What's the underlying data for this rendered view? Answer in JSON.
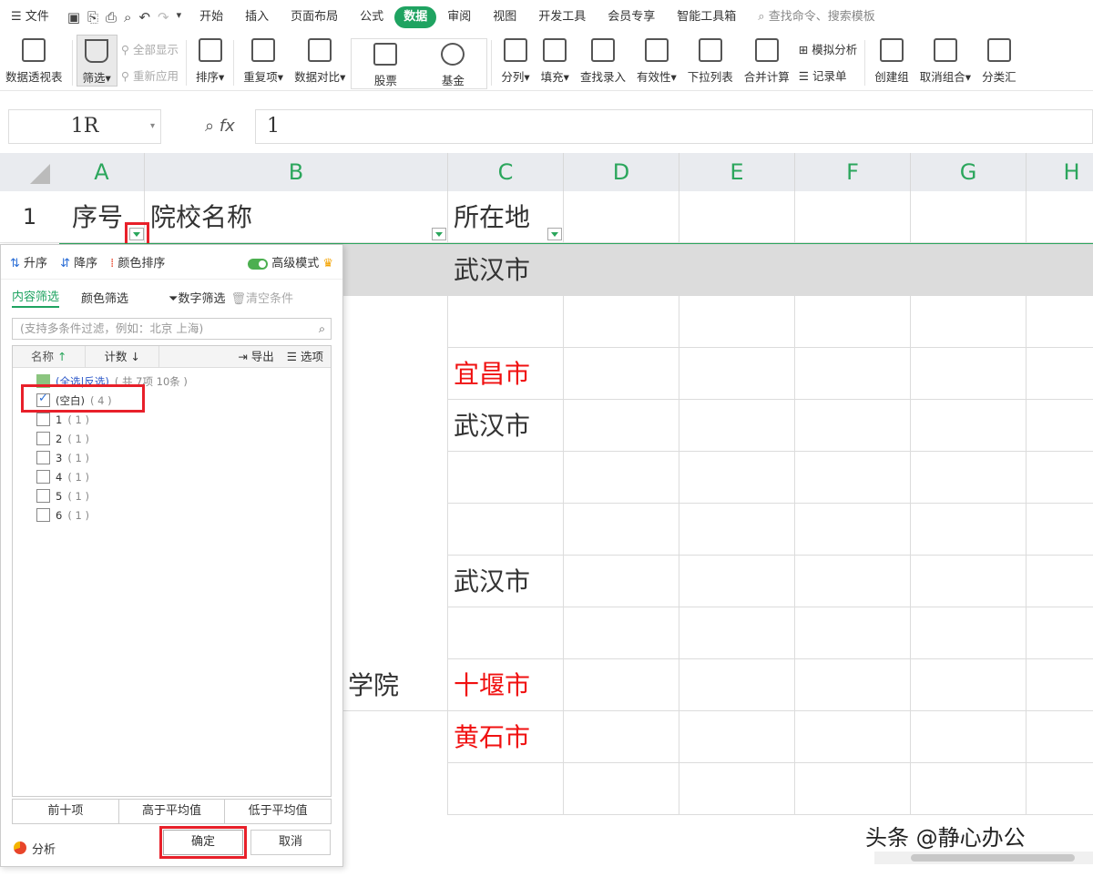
{
  "menubar": {
    "file": "文件",
    "tabs": [
      "开始",
      "插入",
      "页面布局",
      "公式",
      "数据",
      "审阅",
      "视图",
      "开发工具",
      "会员专享",
      "智能工具箱"
    ],
    "active_tab": "数据",
    "search_placeholder": "查找命令、搜索模板"
  },
  "ribbon": {
    "pivot": "数据透视表",
    "filter": "筛选",
    "show_all": "全部显示",
    "reapply": "重新应用",
    "sort": "排序",
    "duplicates": "重复项",
    "compare": "数据对比",
    "stocks": "股票",
    "funds": "基金",
    "split": "分列",
    "fill": "填充",
    "lookup": "查找录入",
    "validity": "有效性",
    "dropdown": "下拉列表",
    "consolidate": "合并计算",
    "simulate": "模拟分析",
    "record": "记录单",
    "group": "创建组",
    "ungroup": "取消组合",
    "subtotal": "分类汇"
  },
  "formula": {
    "cell_ref": "1R",
    "value": "1"
  },
  "columns": [
    "A",
    "B",
    "C",
    "D",
    "E",
    "F",
    "G",
    "H"
  ],
  "header_row": {
    "row_num": "1",
    "a": "序号",
    "b": "院校名称",
    "c": "所在地"
  },
  "cells_c": [
    "武汉市",
    "",
    "宜昌市",
    "武汉市",
    "",
    "",
    "武汉市",
    "",
    "十堰市",
    "黄石市",
    ""
  ],
  "b_partial": "学院",
  "filter_panel": {
    "sort_asc": "升序",
    "sort_desc": "降序",
    "color_sort": "颜色排序",
    "advanced": "高级模式",
    "tab_content": "内容筛选",
    "tab_color": "颜色筛选",
    "num_filter": "数字筛选",
    "clear": "清空条件",
    "search_placeholder": "(支持多条件过滤，例如：北京 上海)",
    "col_name": "名称",
    "col_count": "计数",
    "export": "导出",
    "options": "选项",
    "select_all": "(全选|反选)",
    "select_all_count": "( 共 7项 10条 )",
    "items": [
      {
        "label": "(空白)",
        "count": "( 4 )",
        "checked": true
      },
      {
        "label": "1",
        "count": "( 1 )",
        "checked": false
      },
      {
        "label": "2",
        "count": "( 1 )",
        "checked": false
      },
      {
        "label": "3",
        "count": "( 1 )",
        "checked": false
      },
      {
        "label": "4",
        "count": "( 1 )",
        "checked": false
      },
      {
        "label": "5",
        "count": "( 1 )",
        "checked": false
      },
      {
        "label": "6",
        "count": "( 1 )",
        "checked": false
      }
    ],
    "top10": "前十项",
    "above_avg": "高于平均值",
    "below_avg": "低于平均值",
    "analysis": "分析",
    "ok": "确定",
    "cancel": "取消"
  },
  "watermark": "头条 @静心办公"
}
